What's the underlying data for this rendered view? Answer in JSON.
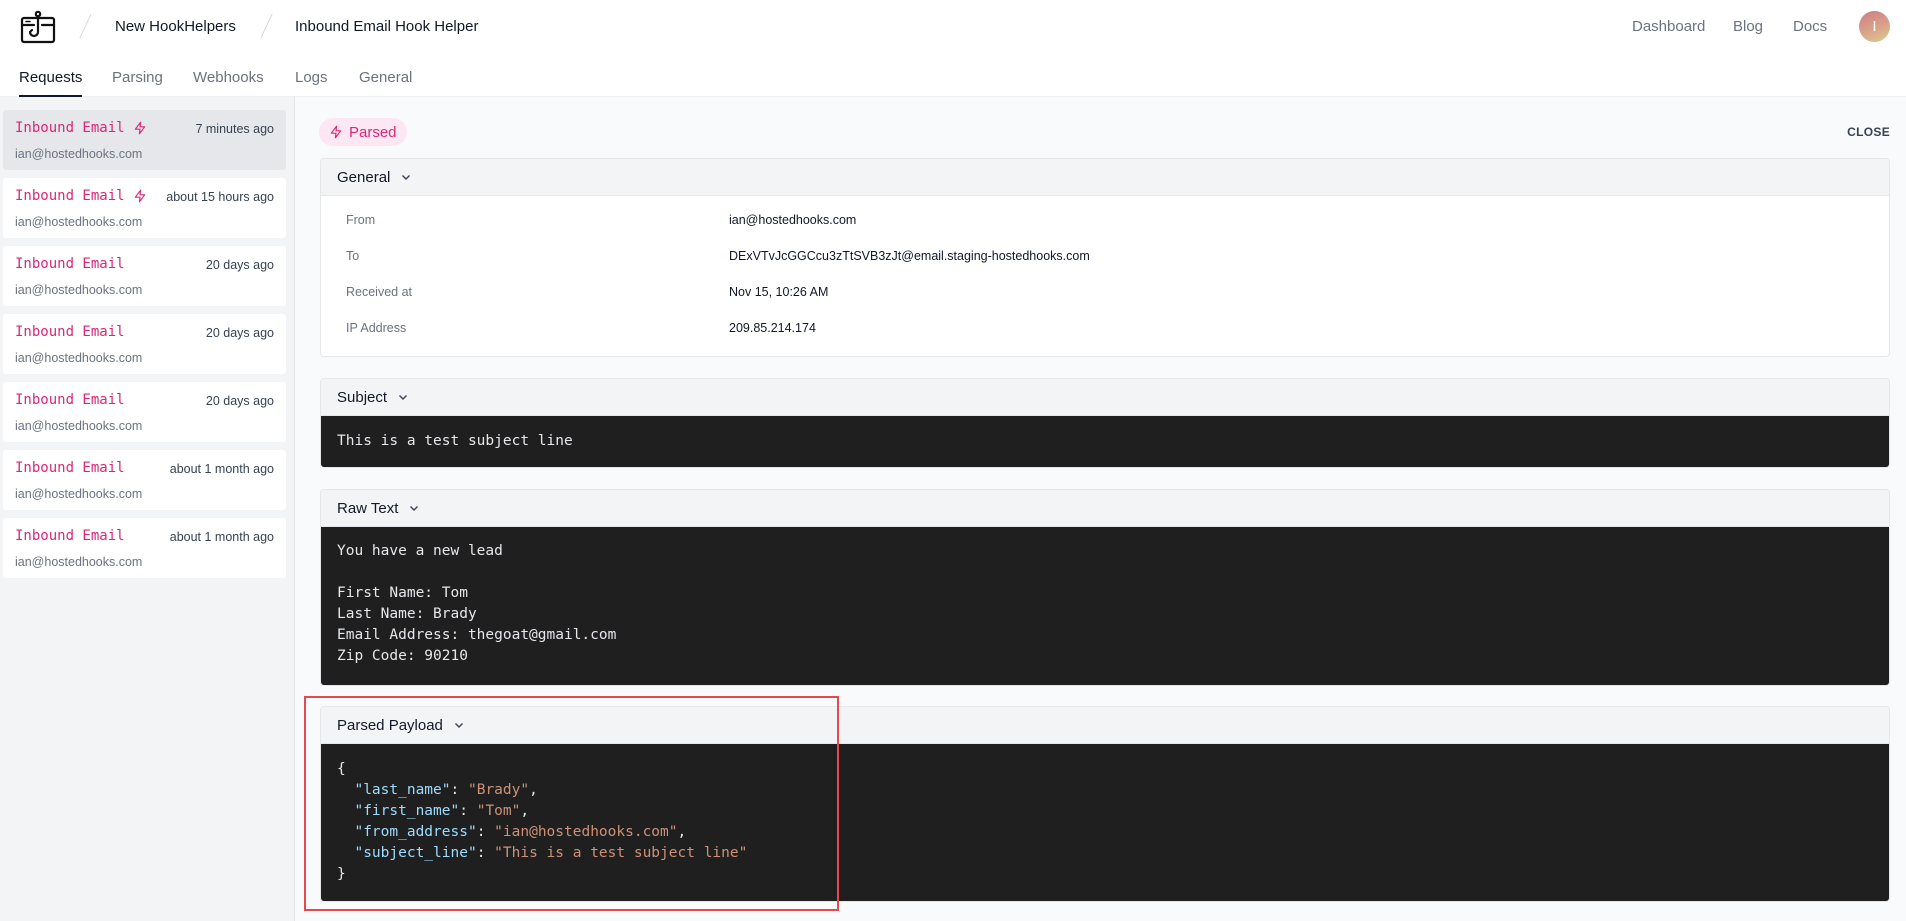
{
  "header": {
    "logo_icon": "hook-browser-icon",
    "breadcrumbs": [
      "New HookHelpers",
      "Inbound Email Hook Helper"
    ],
    "nav": [
      "Dashboard",
      "Blog",
      "Docs"
    ],
    "avatar_initial": "I"
  },
  "tabs": [
    {
      "label": "Requests",
      "active": true
    },
    {
      "label": "Parsing",
      "active": false
    },
    {
      "label": "Webhooks",
      "active": false
    },
    {
      "label": "Logs",
      "active": false
    },
    {
      "label": "General",
      "active": false
    }
  ],
  "sidebar": {
    "items": [
      {
        "title": "Inbound Email",
        "parsed": true,
        "time": "7 minutes ago",
        "email": "ian@hostedhooks.com",
        "selected": true
      },
      {
        "title": "Inbound Email",
        "parsed": true,
        "time": "about 15 hours ago",
        "email": "ian@hostedhooks.com",
        "selected": false
      },
      {
        "title": "Inbound Email",
        "parsed": false,
        "time": "20 days ago",
        "email": "ian@hostedhooks.com",
        "selected": false
      },
      {
        "title": "Inbound Email",
        "parsed": false,
        "time": "20 days ago",
        "email": "ian@hostedhooks.com",
        "selected": false
      },
      {
        "title": "Inbound Email",
        "parsed": false,
        "time": "20 days ago",
        "email": "ian@hostedhooks.com",
        "selected": false
      },
      {
        "title": "Inbound Email",
        "parsed": false,
        "time": "about 1 month ago",
        "email": "ian@hostedhooks.com",
        "selected": false
      },
      {
        "title": "Inbound Email",
        "parsed": false,
        "time": "about 1 month ago",
        "email": "ian@hostedhooks.com",
        "selected": false
      }
    ]
  },
  "detail": {
    "status_badge": "Parsed",
    "close_label": "CLOSE",
    "general": {
      "title": "General",
      "rows": [
        {
          "label": "From",
          "value": "ian@hostedhooks.com"
        },
        {
          "label": "To",
          "value": "DExVTvJcGGCcu3zTtSVB3zJt@email.staging-hostedhooks.com"
        },
        {
          "label": "Received at",
          "value": "Nov 15, 10:26 AM"
        },
        {
          "label": "IP Address",
          "value": "209.85.214.174"
        }
      ]
    },
    "subject": {
      "title": "Subject",
      "text": "This is a test subject line"
    },
    "raw_text": {
      "title": "Raw Text",
      "lines": [
        "You have a new lead",
        "",
        "First Name: Tom",
        "Last Name: Brady",
        "Email Address: thegoat@gmail.com",
        "Zip Code: 90210"
      ]
    },
    "parsed_payload": {
      "title": "Parsed Payload",
      "entries": [
        {
          "key": "last_name",
          "value": "Brady"
        },
        {
          "key": "first_name",
          "value": "Tom"
        },
        {
          "key": "from_address",
          "value": "ian@hostedhooks.com"
        },
        {
          "key": "subject_line",
          "value": "This is a test subject line"
        }
      ]
    }
  },
  "colors": {
    "accent_pink": "#db2777",
    "badge_bg": "#fce7f3",
    "code_bg": "#1f1f1f",
    "json_key": "#9cdcfe",
    "json_string": "#ce9178",
    "highlight_border": "#e5484d"
  }
}
